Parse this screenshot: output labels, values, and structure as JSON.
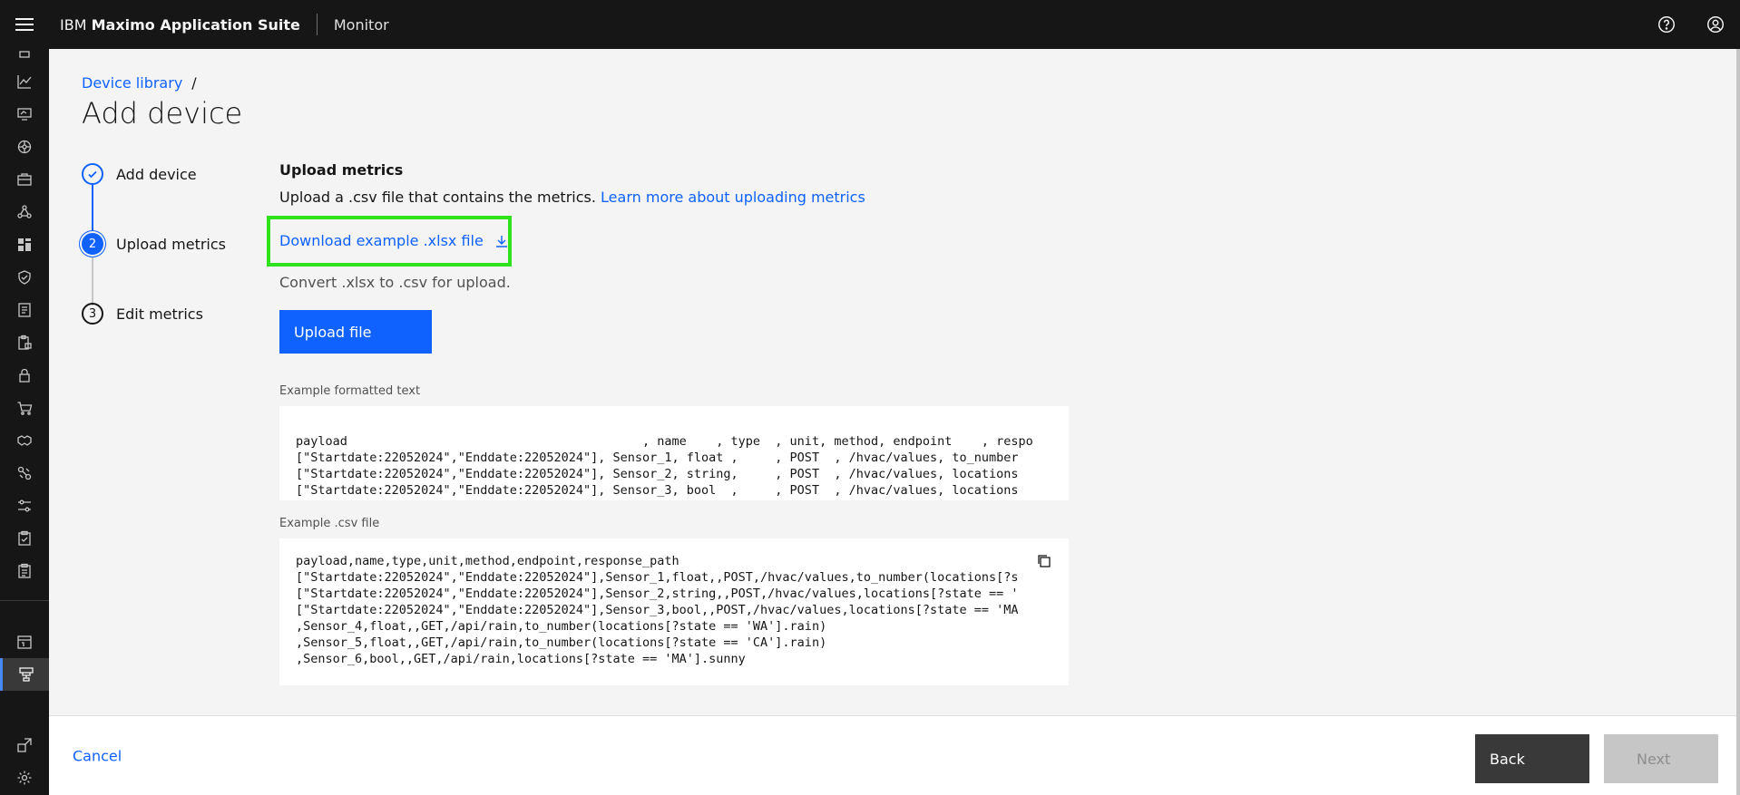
{
  "header": {
    "brand_prefix": "IBM",
    "brand_name": "Maximo Application Suite",
    "app_name": "Monitor",
    "icons": [
      "menu-icon",
      "help-icon",
      "user-avatar-icon"
    ]
  },
  "rail": {
    "icons": [
      "rail-icon-top",
      "chart-line-icon",
      "monitor-icon",
      "network-icon",
      "toolbox-icon",
      "model-icon",
      "dashboard-icon",
      "shield-check-icon",
      "report-icon",
      "clipboard-lock-icon",
      "lock-icon",
      "cart-icon",
      "handshake-icon",
      "tools-icon",
      "sliders-icon",
      "checklist-icon",
      "clipboard-icon",
      "calendar-icon",
      "device-library-icon",
      "launch-icon",
      "settings-icon"
    ],
    "active": "device-library-icon"
  },
  "breadcrumb": {
    "link": "Device library",
    "separator": "/"
  },
  "page": {
    "title": "Add device"
  },
  "progress": {
    "steps": [
      {
        "label": "Add device",
        "number": "",
        "state": "complete"
      },
      {
        "label": "Upload metrics",
        "number": "2",
        "state": "current"
      },
      {
        "label": "Edit metrics",
        "number": "3",
        "state": "incomplete"
      }
    ]
  },
  "upload": {
    "title": "Upload metrics",
    "description": "Upload a .csv file that contains the metrics.",
    "learn_more": "Learn more about uploading metrics",
    "download_link": "Download example .xlsx file",
    "convert_note": "Convert .xlsx to .csv for upload.",
    "upload_button": "Upload file"
  },
  "formatted_example": {
    "label": "Example formatted text",
    "text": "payload                                        , name    , type  , unit, method, endpoint    , respo\n[\"Startdate:22052024\",\"Enddate:22052024\"], Sensor_1, float ,     , POST  , /hvac/values, to_number\n[\"Startdate:22052024\",\"Enddate:22052024\"], Sensor_2, string,     , POST  , /hvac/values, locations\n[\"Startdate:22052024\",\"Enddate:22052024\"], Sensor_3, bool  ,     , POST  , /hvac/values, locations"
  },
  "csv_example": {
    "label": "Example .csv file",
    "text": "payload,name,type,unit,method,endpoint,response_path\n[\"Startdate:22052024\",\"Enddate:22052024\"],Sensor_1,float,,POST,/hvac/values,to_number(locations[?s\n[\"Startdate:22052024\",\"Enddate:22052024\"],Sensor_2,string,,POST,/hvac/values,locations[?state == '\n[\"Startdate:22052024\",\"Enddate:22052024\"],Sensor_3,bool,,POST,/hvac/values,locations[?state == 'MA\n,Sensor_4,float,,GET,/api/rain,to_number(locations[?state == 'WA'].rain)\n,Sensor_5,float,,GET,/api/rain,to_number(locations[?state == 'CA'].rain)\n,Sensor_6,bool,,GET,/api/rain,locations[?state == 'MA'].sunny",
    "copy_icon": "copy-icon"
  },
  "footer": {
    "cancel": "Cancel",
    "back": "Back",
    "next": "Next"
  },
  "colors": {
    "primary": "#0f62fe",
    "highlight": "#2ee21c",
    "header_bg": "#161616"
  }
}
